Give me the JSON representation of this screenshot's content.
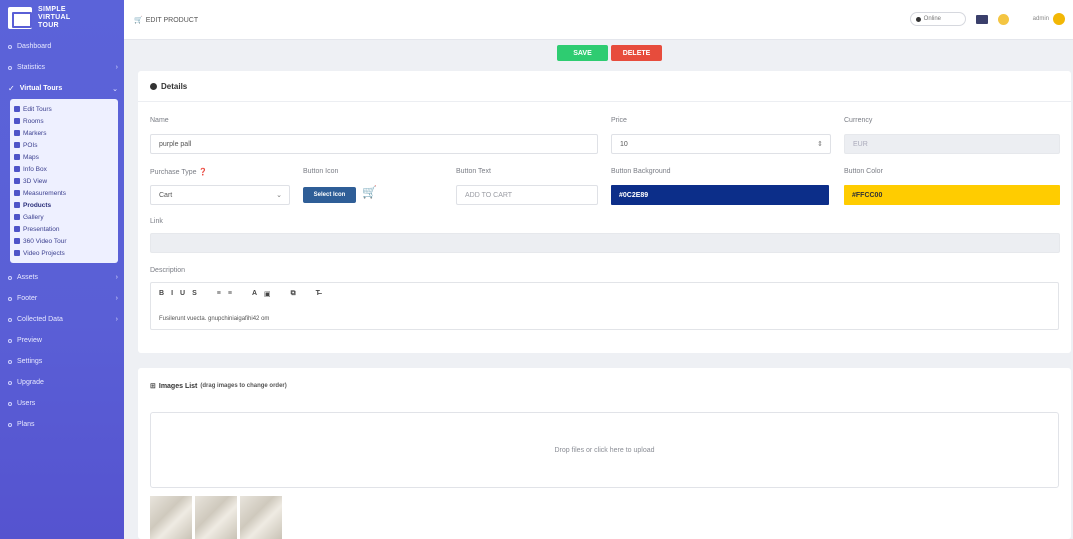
{
  "sidebar": {
    "logo_line1": "SIMPLE",
    "logo_line2": "VIRTUAL",
    "logo_line3": "TOUR",
    "items_top": [
      {
        "label": "Dashboard"
      },
      {
        "label": "Statistics"
      }
    ],
    "active_item": "Virtual Tours",
    "submenu": [
      {
        "label": "Edit Tours"
      },
      {
        "label": "Rooms"
      },
      {
        "label": "Markers"
      },
      {
        "label": "POIs"
      },
      {
        "label": "Maps"
      },
      {
        "label": "Info Box"
      },
      {
        "label": "3D View"
      },
      {
        "label": "Measurements"
      },
      {
        "label": "Products"
      },
      {
        "label": "Gallery"
      },
      {
        "label": "Presentation"
      },
      {
        "label": "360 Video Tour"
      },
      {
        "label": "Video Projects"
      }
    ],
    "items_bottom": [
      {
        "label": "Assets"
      },
      {
        "label": "Footer"
      },
      {
        "label": "Collected Data"
      },
      {
        "label": "Preview"
      },
      {
        "label": "Settings"
      },
      {
        "label": "Upgrade"
      },
      {
        "label": "Users"
      },
      {
        "label": "Plans"
      }
    ]
  },
  "topbar": {
    "breadcrumb": "EDIT PRODUCT",
    "status_label": "Online",
    "user_label": "admin"
  },
  "actions": {
    "save": "SAVE",
    "delete": "DELETE"
  },
  "details": {
    "title": "Details",
    "name_label": "Name",
    "name_value": "purple pall",
    "price_label": "Price",
    "price_value": "10",
    "currency_label": "Currency",
    "currency_value": "EUR",
    "purchase_type_label": "Purchase Type",
    "purchase_type_value": "Cart",
    "button_icon_label": "Button Icon",
    "select_icon_button": "Select Icon",
    "button_text_label": "Button Text",
    "button_text_placeholder": "ADD TO CART",
    "button_bg_label": "Button Background",
    "button_bg_value": "#0C2E89",
    "button_color_label": "Button Color",
    "button_color_value": "#FFCC00",
    "link_label": "Link",
    "description_label": "Description",
    "toolbar": [
      "B",
      "I",
      "U",
      "S",
      "≡",
      "≡",
      "A",
      "▣",
      "⧉",
      "T̶"
    ],
    "description_text": "Fusilerunt vuecta. gnupchiniaigafihi42 om"
  },
  "images": {
    "title": "Images List",
    "subtitle": "(drag images to change order)",
    "dropzone_text": "Drop files or click here to upload"
  },
  "colors": {
    "sidebar": "#5a5fd6",
    "save": "#2ecc71",
    "delete": "#e74c3c",
    "button_bg": "#0C2E89",
    "button_color": "#FFCC00"
  }
}
